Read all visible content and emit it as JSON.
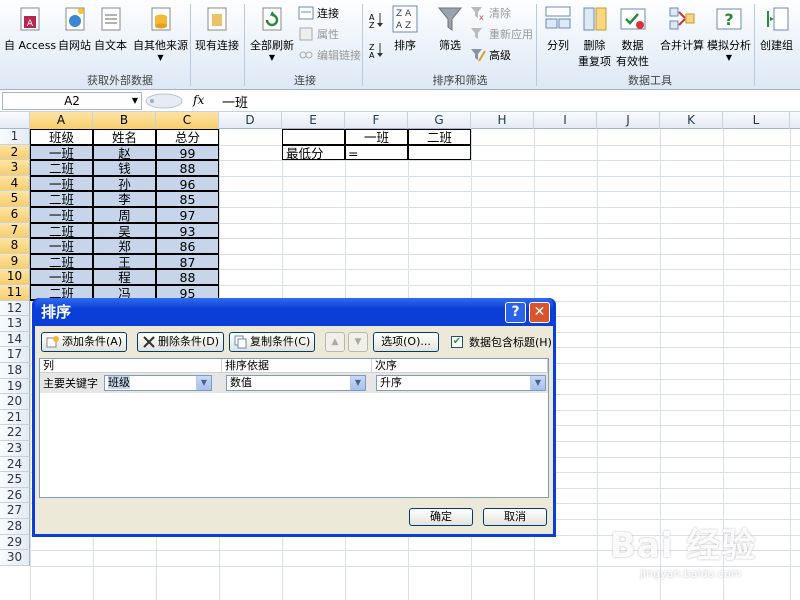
{
  "ribbon": {
    "buttons": {
      "access": "自 Access",
      "web": "自网站",
      "text": "自文本",
      "other": "自其他来源",
      "existing": "现有连接",
      "refresh_all": "全部刷新",
      "connections": "连接",
      "properties": "属性",
      "edit_links": "编辑链接",
      "sort": "排序",
      "filter": "筛选",
      "clear": "清除",
      "reapply": "重新应用",
      "advanced": "高级",
      "text_to_columns": "分列",
      "remove_duplicates": "删除",
      "remove_duplicates_2": "重复项",
      "data_validation": "数据",
      "data_validation_2": "有效性",
      "consolidate": "合并计算",
      "whatif": "模拟分析",
      "group": "创建组"
    },
    "groups": {
      "external": "获取外部数据",
      "connections": "连接",
      "sort_filter": "排序和筛选",
      "data_tools": "数据工具"
    }
  },
  "formula_bar": {
    "name_box": "A2",
    "fx": "fx",
    "value": "一班"
  },
  "sheet": {
    "columns": [
      "A",
      "B",
      "C",
      "D",
      "E",
      "F",
      "G",
      "H",
      "I",
      "J",
      "K",
      "L"
    ],
    "rows": [
      "1",
      "2",
      "3",
      "4",
      "5",
      "6",
      "7",
      "8",
      "9",
      "10",
      "11",
      "12",
      "13",
      "14",
      "17",
      "18",
      "19",
      "20",
      "21",
      "22",
      "23",
      "24",
      "25",
      "26",
      "27",
      "28",
      "29",
      "30"
    ],
    "table_header": [
      "班级",
      "姓名",
      "总分"
    ],
    "table_rows": [
      [
        "一班",
        "赵",
        "99"
      ],
      [
        "二班",
        "钱",
        "88"
      ],
      [
        "一班",
        "孙",
        "96"
      ],
      [
        "二班",
        "李",
        "85"
      ],
      [
        "一班",
        "周",
        "97"
      ],
      [
        "二班",
        "吴",
        "93"
      ],
      [
        "一班",
        "郑",
        "86"
      ],
      [
        "二班",
        "王",
        "87"
      ],
      [
        "一班",
        "程",
        "88"
      ],
      [
        "二班",
        "冯",
        "95"
      ]
    ],
    "side": {
      "f1": "一班",
      "g1": "二班",
      "e2": "最低分",
      "f2": "="
    }
  },
  "dialog": {
    "title": "排序",
    "help": "?",
    "close": "✕",
    "add_level": "添加条件(A)",
    "delete_level": "删除条件(D)",
    "copy_level": "复制条件(C)",
    "options": "选项(O)...",
    "header_checkbox": "数据包含标题(H)",
    "header_checked": true,
    "col_column": "列",
    "col_sort_on": "排序依据",
    "col_order": "次序",
    "row_label": "主要关键字",
    "row_column": "班级",
    "row_sort_on": "数值",
    "row_order": "升序",
    "ok": "确定",
    "cancel": "取消"
  },
  "watermark": {
    "main": "Bai 经验",
    "url": "jingyan.baidu.com"
  },
  "colors": {
    "dialog_frame": "#0a3ed6",
    "selection_fill": "#c6d5ea",
    "header_selected": "#f8ce6b"
  }
}
